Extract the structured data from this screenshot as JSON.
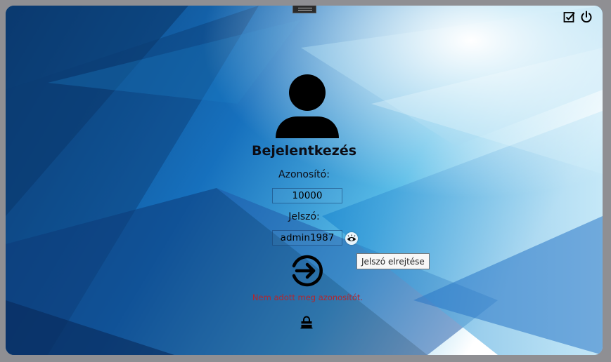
{
  "login": {
    "title": "Bejelentkezés",
    "id_label": "Azonosító:",
    "id_value": "10000",
    "password_label": "Jelszó:",
    "password_value": "admin1987",
    "hide_password_tooltip": "Jelszó elrejtése",
    "error_message": "Nem adott meg azonosítót."
  },
  "icons": {
    "top_bar": [
      "checkbox-edit-icon",
      "power-icon"
    ],
    "avatar": "user-icon",
    "show_password": "eye-icon",
    "login": "arrow-right-circle-icon",
    "lock": "lock-icon"
  },
  "colors": {
    "error": "#b3262e",
    "text": "#0c0c14"
  }
}
